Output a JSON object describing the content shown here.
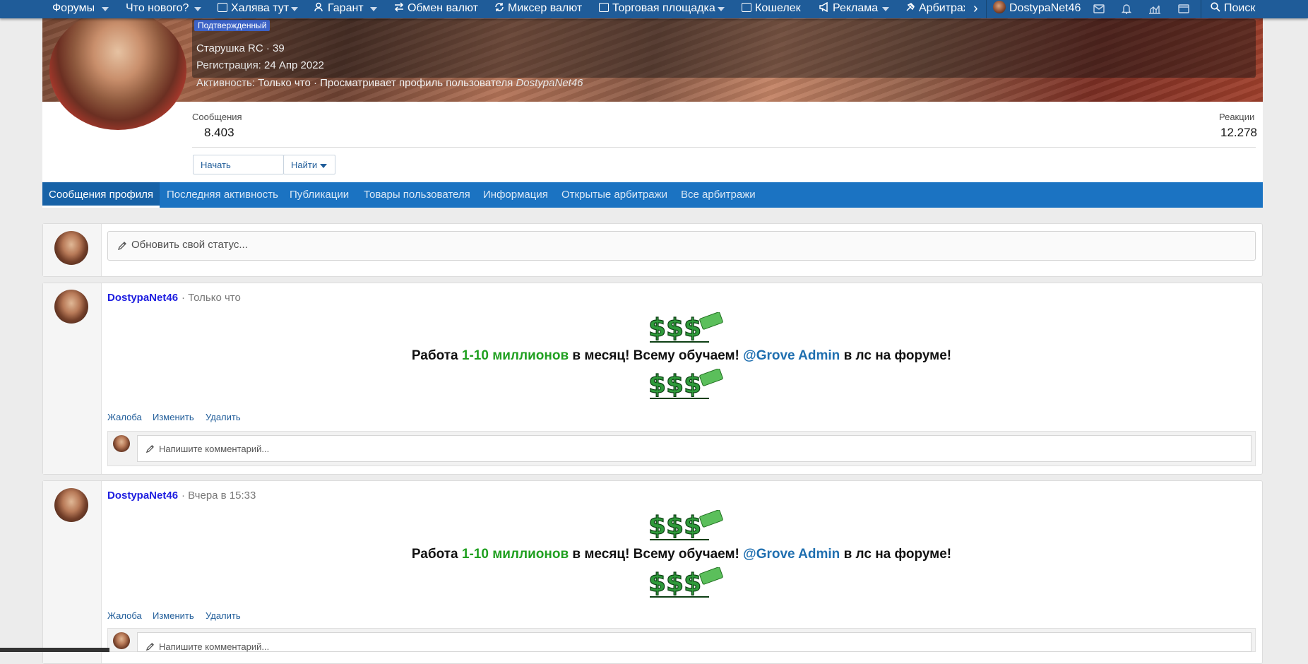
{
  "navbar": {
    "items": [
      {
        "label": "Форумы",
        "icon": ""
      },
      {
        "label": "Что нового?",
        "icon": ""
      },
      {
        "label": "Халява тут",
        "icon": "gift-card-icon"
      },
      {
        "label": "Гарант",
        "icon": "user-guarantee-icon"
      },
      {
        "label": "Обмен валют",
        "icon": "exchange-icon"
      },
      {
        "label": "Миксер валют",
        "icon": "mixer-icon"
      },
      {
        "label": "Торговая площадка",
        "icon": "store-icon"
      },
      {
        "label": "Кошелек",
        "icon": "wallet-icon"
      },
      {
        "label": "Реклама",
        "icon": "megaphone-icon"
      },
      {
        "label": "Арбитраж",
        "icon": "gavel-icon"
      }
    ],
    "scroll_arrow": "›",
    "username": "DostypaNet46",
    "search_label": "Поиск"
  },
  "profile": {
    "badge": "Подтвержденный",
    "title_line": "Старушка RC · 39",
    "registration_label": "Регистрация:",
    "registration_value": "24 Апр 2022",
    "activity_label": "Активность:",
    "activity_value": "Только что · Просматривает профиль пользователя",
    "activity_user": "DostypaNet46",
    "messages_label": "Сообщения",
    "messages_value": "8.403",
    "reactions_label": "Реакции",
    "reactions_value": "12.278",
    "start_conversation": "Начать переписку",
    "find_label": "Найти"
  },
  "tabs": [
    "Сообщения профиля",
    "Последняя активность",
    "Публикации",
    "Товары пользователя",
    "Информация",
    "Открытые арбитражи",
    "Все арбитражи"
  ],
  "status_placeholder": "Обновить свой статус...",
  "posts": [
    {
      "author": "DostypaNet46",
      "time": "· Только что",
      "text_start": "Работа ",
      "text_green": "1-10 миллионов",
      "text_mid": " в месяц! Всему обучаем! ",
      "text_mention": "@Grove Admin",
      "text_end": " в лс на форуме!",
      "actions": [
        "Жалоба",
        "Изменить",
        "Удалить"
      ],
      "comment_placeholder": "Напишите комментарий..."
    },
    {
      "author": "DostypaNet46",
      "time": "· Вчера в 15:33",
      "text_start": "Работа ",
      "text_green": "1-10 миллионов",
      "text_mid": " в месяц! Всему обучаем! ",
      "text_mention": "@Grove Admin",
      "text_end": " в лс на форуме!",
      "actions": [
        "Жалоба",
        "Изменить",
        "Удалить"
      ],
      "comment_placeholder": "Напишите комментарий..."
    }
  ],
  "colors": {
    "navbar": "#1f5c99",
    "tabs": "#1b73c2",
    "link": "#1f5c99",
    "author": "#1d1de0",
    "promo_green": "#20a020",
    "mention": "#1f6fb0",
    "badge": "#3c63c7"
  }
}
